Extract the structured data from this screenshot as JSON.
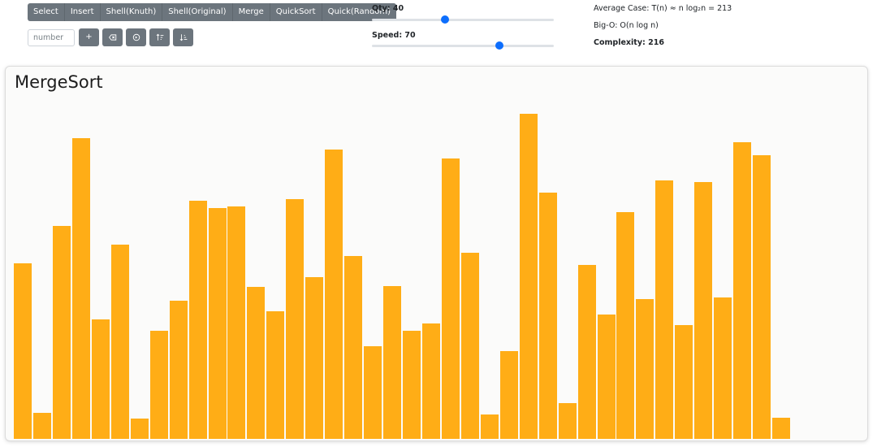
{
  "toolbar": {
    "algorithms": [
      "Select",
      "Insert",
      "Shell(Knuth)",
      "Shell(Original)",
      "Merge",
      "QuickSort",
      "Quick(Random)"
    ],
    "number_placeholder": "number",
    "add_label": "+"
  },
  "qty": {
    "label": "Qty: 40",
    "value": 40,
    "min": 0,
    "max": 100
  },
  "speed": {
    "label": "Speed: 70",
    "value": 70,
    "min": 0,
    "max": 100
  },
  "info": {
    "average_case": "Average Case: T(n) ≈ n log₂n = 213",
    "big_o": "Big-O: O(n log n)",
    "complexity": "Complexity: 216"
  },
  "panel": {
    "title": "MergeSort"
  },
  "colors": {
    "bar": "#ffad16",
    "button": "#6c757d",
    "accent": "#0d6efd"
  },
  "chart_data": {
    "type": "bar",
    "max_value": 418,
    "values": [
      216,
      32,
      262,
      370,
      147,
      239,
      25,
      133,
      170,
      293,
      284,
      286,
      187,
      157,
      295,
      199,
      356,
      225,
      114,
      188,
      133,
      142,
      345,
      229,
      30,
      108,
      400,
      303,
      44,
      214,
      153,
      279,
      172,
      318,
      140,
      316,
      174,
      365,
      349,
      26
    ]
  }
}
